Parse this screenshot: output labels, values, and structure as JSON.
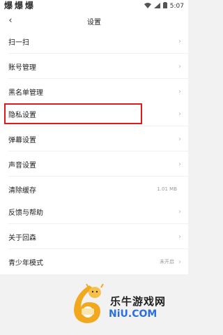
{
  "status_bar": {
    "app_icons": [
      "爆",
      "爆",
      "爆"
    ],
    "time": "5:07"
  },
  "header": {
    "title": "设置"
  },
  "sections": [
    {
      "items": [
        {
          "label": "扫一扫"
        },
        {
          "label": "账号管理"
        },
        {
          "label": "黑名单管理"
        }
      ]
    },
    {
      "items": [
        {
          "label": "隐私设置"
        },
        {
          "label": "弹幕设置"
        },
        {
          "label": "声音设置"
        },
        {
          "label": "清除缓存",
          "value": "1.01 MB"
        }
      ]
    },
    {
      "items": [
        {
          "label": "反馈与帮助"
        },
        {
          "label": "关于回森"
        },
        {
          "label": "青少年模式",
          "value": "未开启"
        }
      ]
    }
  ],
  "watermark": {
    "brand": "乐牛游戏网",
    "domain": "NiU.COM"
  },
  "colors": {
    "highlight": "#e0191c"
  }
}
